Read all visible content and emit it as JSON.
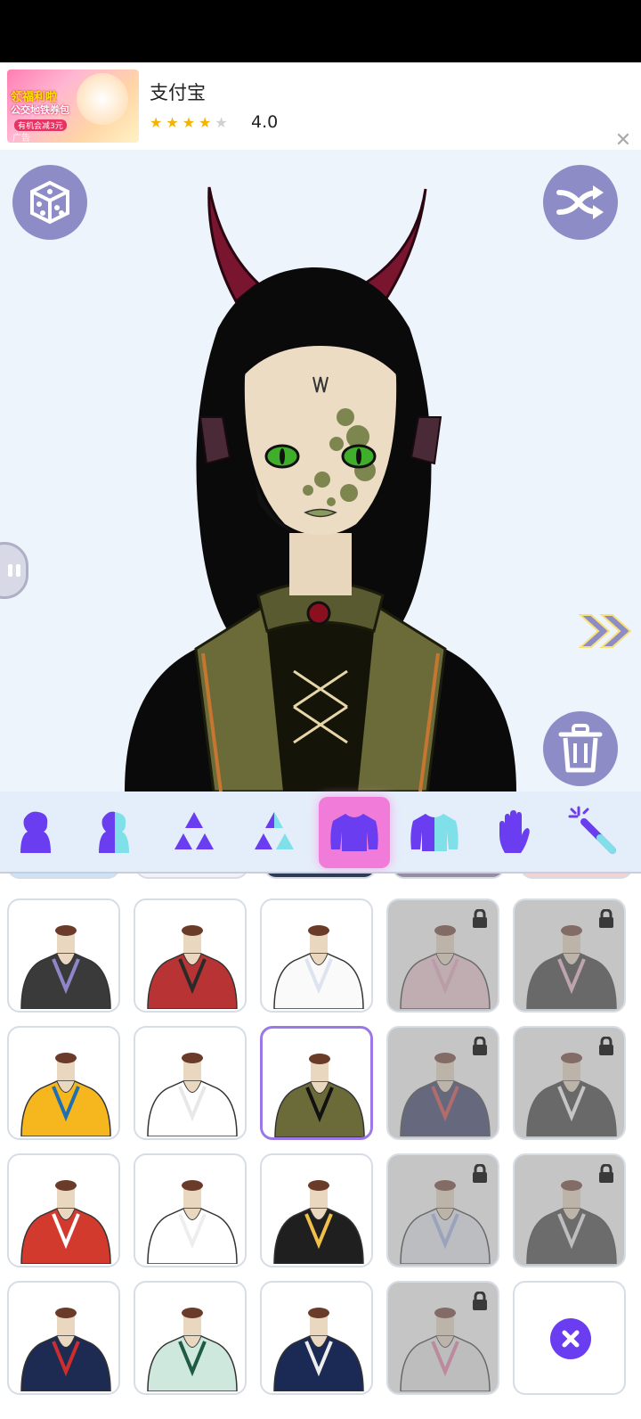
{
  "ad": {
    "thumb_line1": "领福利啦",
    "thumb_line2": "公交地铁券包",
    "thumb_line3": "有机会减3元",
    "thumb_tag": "广告",
    "title": "支付宝",
    "rating": "4.0",
    "rating_value": 4,
    "rating_max": 5
  },
  "colors": {
    "accent": "#6a3df0",
    "button": "#8d8cc7",
    "active_tab": "#f07bd8",
    "selected_border": "#9b78e8"
  },
  "toolbar": {
    "random_icon": "dice-icon",
    "shuffle_icon": "shuffle-icon",
    "delete_icon": "trash-icon",
    "next_icon": "double-chevron-right-icon"
  },
  "categories": [
    {
      "name": "body",
      "icon": "body-icon"
    },
    {
      "name": "body-color",
      "icon": "body-half-icon"
    },
    {
      "name": "layers",
      "icon": "triangles-icon"
    },
    {
      "name": "layers-color",
      "icon": "triangles-half-icon"
    },
    {
      "name": "top",
      "icon": "shirt-icon",
      "active": true
    },
    {
      "name": "top-color",
      "icon": "shirt-half-icon"
    },
    {
      "name": "hand",
      "icon": "hand-icon"
    },
    {
      "name": "effects",
      "icon": "magic-wand-icon"
    }
  ],
  "outfits": [
    {
      "id": "choker-strap",
      "locked": false
    },
    {
      "id": "red-blazer",
      "locked": false
    },
    {
      "id": "white-blouse",
      "locked": false
    },
    {
      "id": "pink-frill",
      "locked": true
    },
    {
      "id": "gothic-ribbon",
      "locked": true
    },
    {
      "id": "yellow-hoodie",
      "locked": false
    },
    {
      "id": "fur-stole",
      "locked": false
    },
    {
      "id": "green-vest",
      "locked": false,
      "selected": true
    },
    {
      "id": "sailor",
      "locked": true
    },
    {
      "id": "maid-apron",
      "locked": true
    },
    {
      "id": "red-offshoulder",
      "locked": false
    },
    {
      "id": "white-bow",
      "locked": false
    },
    {
      "id": "black-cross",
      "locked": false
    },
    {
      "id": "lace-dress",
      "locked": true
    },
    {
      "id": "button-coat",
      "locked": true
    },
    {
      "id": "navy-lace",
      "locked": false
    },
    {
      "id": "mint-kimono",
      "locked": false
    },
    {
      "id": "blue-cutout",
      "locked": false
    },
    {
      "id": "harness",
      "locked": true
    },
    {
      "id": "none",
      "icon": "close-icon"
    }
  ]
}
